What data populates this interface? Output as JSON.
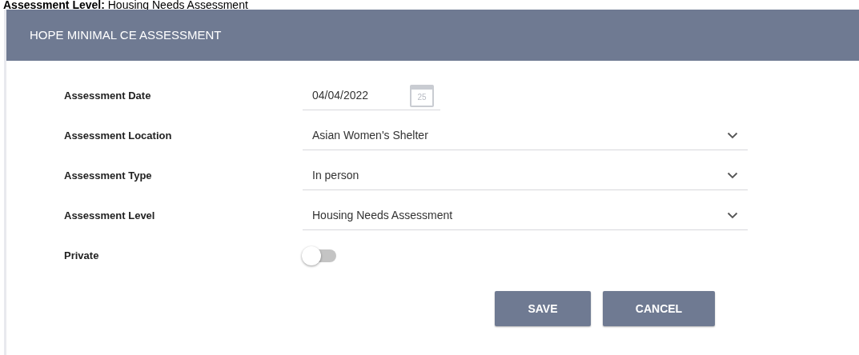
{
  "page_heading": {
    "label": "Assessment Level:",
    "value": "Housing Needs Assessment"
  },
  "panel": {
    "title": "HOPE MINIMAL CE ASSESSMENT"
  },
  "fields": [
    {
      "kind": "date",
      "label": "Assessment Date",
      "value": "04/04/2022",
      "icon_text": "25"
    },
    {
      "kind": "select",
      "label": "Assessment Location",
      "value": "Asian Women's Shelter"
    },
    {
      "kind": "select",
      "label": "Assessment Type",
      "value": "In person"
    },
    {
      "kind": "select",
      "label": "Assessment Level",
      "value": "Housing Needs Assessment"
    },
    {
      "kind": "toggle",
      "label": "Private",
      "on": false
    }
  ],
  "buttons": [
    "SAVE",
    "CANCEL"
  ]
}
